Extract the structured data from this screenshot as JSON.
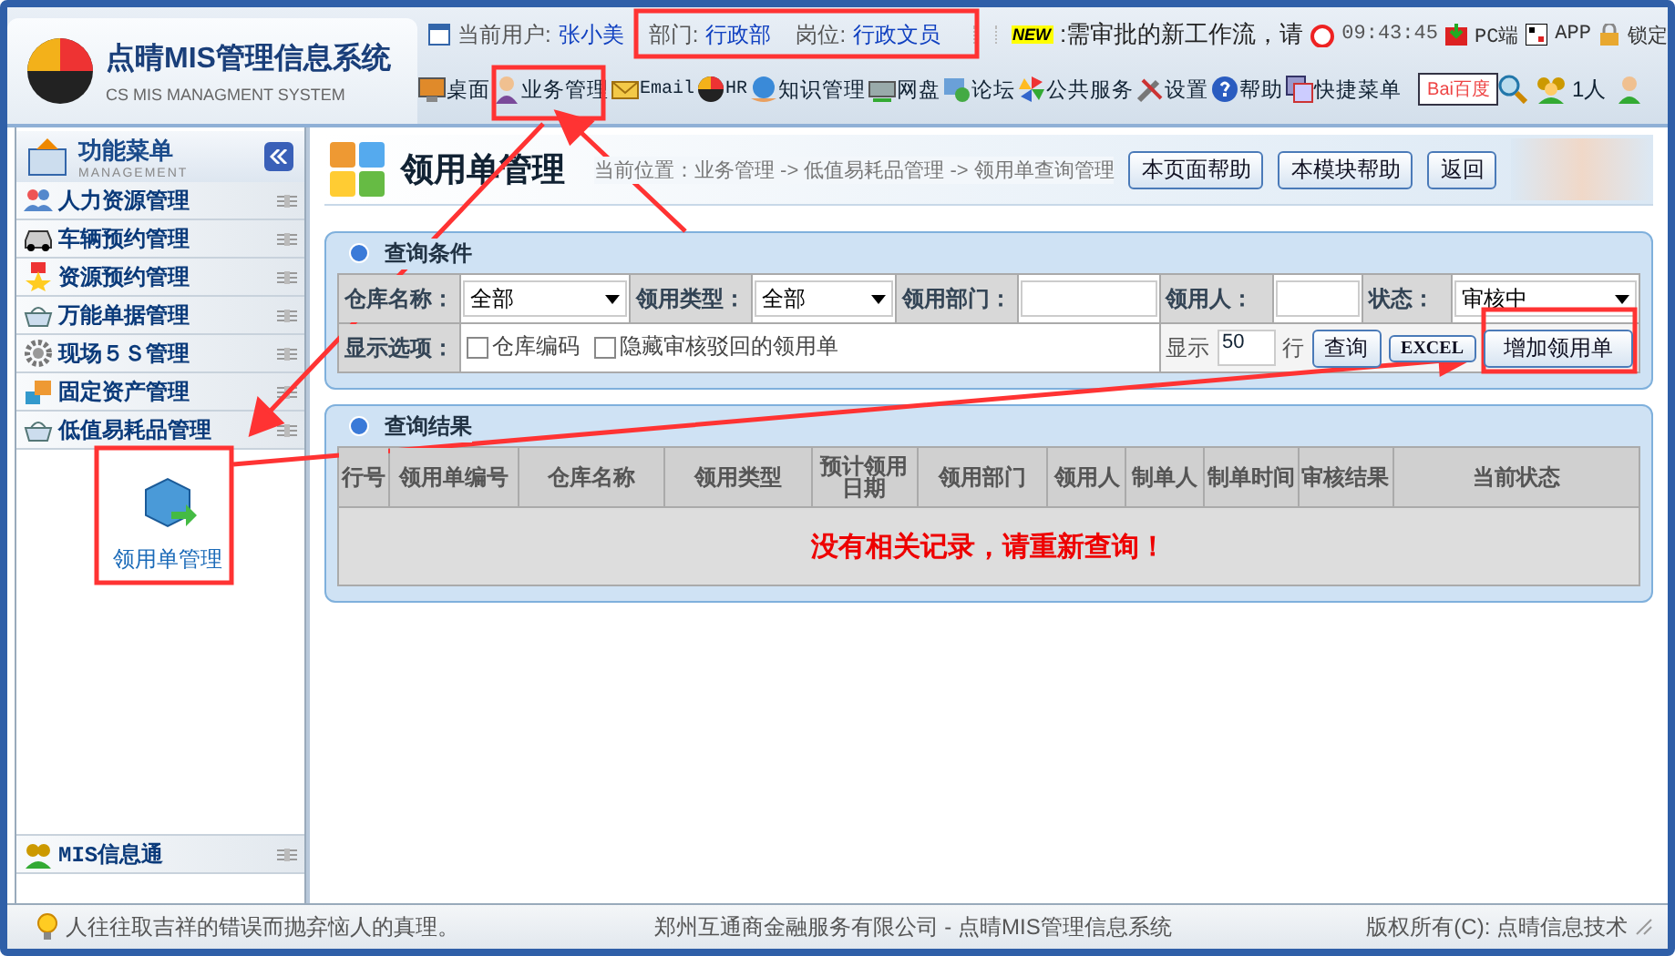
{
  "app": {
    "title": "点晴MIS管理信息系统",
    "subtitle": "CS MIS MANAGMENT SYSTEM"
  },
  "user_bar": {
    "user_label": "当前用户:",
    "user": "张小美",
    "dept_label": "部门:",
    "dept": "行政部",
    "post_label": "岗位:",
    "post": "行政文员",
    "badge": "NEW",
    "notice": ":需审批的新工作流，请",
    "time": "09:43:45",
    "links": [
      "PC端",
      "APP",
      "锁定"
    ]
  },
  "toolbar": {
    "items": [
      "桌面",
      "业务管理",
      "Email",
      "HR",
      "知识管理",
      "网盘",
      "论坛",
      "公共服务",
      "设置",
      "帮助",
      "快捷菜单"
    ],
    "search_logo": "Bai百度",
    "online": "1人"
  },
  "sidebar": {
    "title": "功能菜单",
    "subtitle": "MANAGEMENT",
    "items": [
      {
        "label": "人力资源管理"
      },
      {
        "label": "车辆预约管理"
      },
      {
        "label": "资源预约管理"
      },
      {
        "label": "万能单据管理"
      },
      {
        "label": "现场５Ｓ管理"
      },
      {
        "label": "固定资产管理"
      },
      {
        "label": "低值易耗品管理",
        "children": [
          {
            "label": "领用单管理"
          }
        ]
      }
    ],
    "bottom_item": "MIS信息通"
  },
  "page": {
    "title": "领用单管理",
    "breadcrumb": "当前位置：业务管理 -> 低值易耗品管理 -> 领用单查询管理",
    "buttons": [
      "本页面帮助",
      "本模块帮助",
      "返回"
    ]
  },
  "query": {
    "title": "查询条件",
    "fields": [
      {
        "label": "仓库名称：",
        "kind": "select",
        "value": "全部"
      },
      {
        "label": "领用类型：",
        "kind": "select",
        "value": "全部"
      },
      {
        "label": "领用部门：",
        "kind": "text"
      },
      {
        "label": "领用人：",
        "kind": "text"
      },
      {
        "label": "状态：",
        "kind": "select",
        "value": "审核中"
      }
    ],
    "options_label": "显示选项：",
    "options": [
      {
        "label": "仓库编码",
        "checked": false
      },
      {
        "label": "隐藏审核驳回的领用单",
        "checked": false
      }
    ],
    "rows_before": "显示",
    "rows_value": "50",
    "rows_after": "行",
    "buttons": [
      "查询",
      "EXCEL",
      "增加领用单"
    ]
  },
  "results": {
    "title": "查询结果",
    "columns": [
      "行号",
      "领用单编号",
      "仓库名称",
      "领用类型",
      "预计领用日期",
      "领用部门",
      "领用人",
      "制单人",
      "制单时间",
      "审核结果",
      "当前状态"
    ],
    "empty_message": "没有相关记录，请重新查询！"
  },
  "status_bar": {
    "tip": "人往往取吉祥的错误而抛弃恼人的真理。",
    "company": "郑州互通商金融服务有限公司 - 点晴MIS管理信息系统",
    "copyright": "版权所有(C): 点晴信息技术"
  }
}
